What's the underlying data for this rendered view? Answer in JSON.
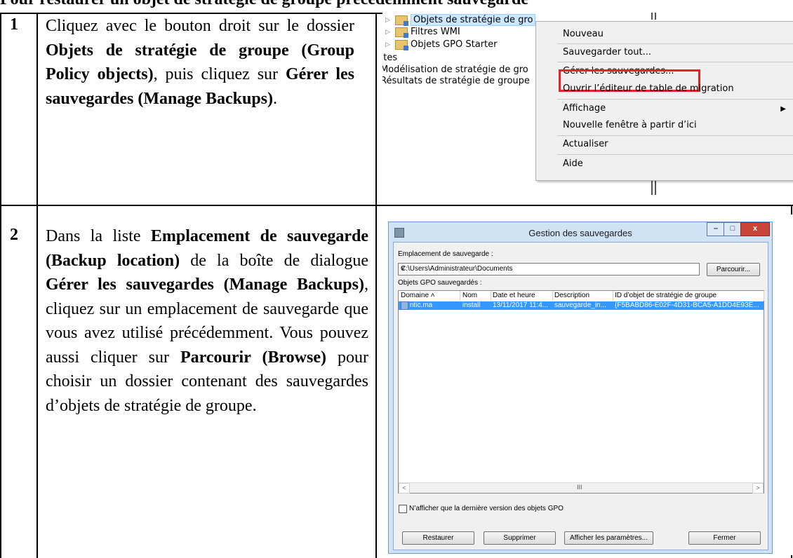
{
  "heading": "Pour restaurer un objet de stratégie de groupe précédemment sauvegardé",
  "rows": [
    {
      "num": "1",
      "text": [
        "Cliquez avec le bouton droit sur le dossier ",
        "Objets de stratégie de groupe (Group Policy objects)",
        ", puis cliquez sur ",
        "Gérer les sauvegardes (Manage Backups)",
        "."
      ]
    },
    {
      "num": "2",
      "text": [
        "Dans la liste ",
        "Emplacement de sauvegarde (Backup location)",
        " de la boîte de dialogue ",
        "Gérer les sauvegardes (Manage Backups)",
        ", cliquez sur un emplacement de sauvegarde que vous avez utilisé précédemment. Vous pouvez aussi cliquer sur ",
        "Parcourir (Browse)",
        " pour choisir un dossier contenant des sauvegardes d’objets de stratégie de groupe."
      ]
    }
  ],
  "screenshot1": {
    "tree": {
      "item0": "Objets de stratégie de gro",
      "item1": "Filtres WMI",
      "item2": "Objets GPO Starter",
      "item3": "iites",
      "item4": "Modélisation de stratégie de gro",
      "item5": "Résultats de stratégie de groupe"
    },
    "menu": {
      "new": "Nouveau",
      "backup_all": "Sauvegarder tout...",
      "manage_backups": "Gérer les sauvegardes...",
      "migration_editor": "Ouvrir l’éditeur de table de migration",
      "view": "Affichage",
      "new_window": "Nouvelle fenêtre à partir d’ici",
      "refresh": "Actualiser",
      "help": "Aide"
    },
    "highlight_color": "#e0242a"
  },
  "screenshot2": {
    "title": "Gestion des sauvegardes",
    "location_label": "Emplacement de sauvegarde :",
    "location_value": "C:\\Users\\Administrateur\\Documents",
    "browse": "Parcourir...",
    "backed_up_label": "Objets GPO sauvegardés :",
    "columns": {
      "domain": "Domaine",
      "name": "Nom",
      "date": "Date et heure",
      "description": "Description",
      "gpo_id": "ID d’objet de stratégie de groupe"
    },
    "row": {
      "domain": "ntic.ma",
      "name": "install",
      "date": "13/11/2017 11:4...",
      "description": "sauvegarde_in...",
      "gpo_id": "{F5BABD86-E02F-4D31-BCA5-A1DD4E93E..."
    },
    "checkbox_label": "N’afficher que la dernière version des objets GPO",
    "buttons": {
      "restore": "Restaurer",
      "delete": "Supprimer",
      "show_settings": "Afficher les paramètres...",
      "close": "Fermer"
    },
    "selection_color": "#3399ff"
  }
}
